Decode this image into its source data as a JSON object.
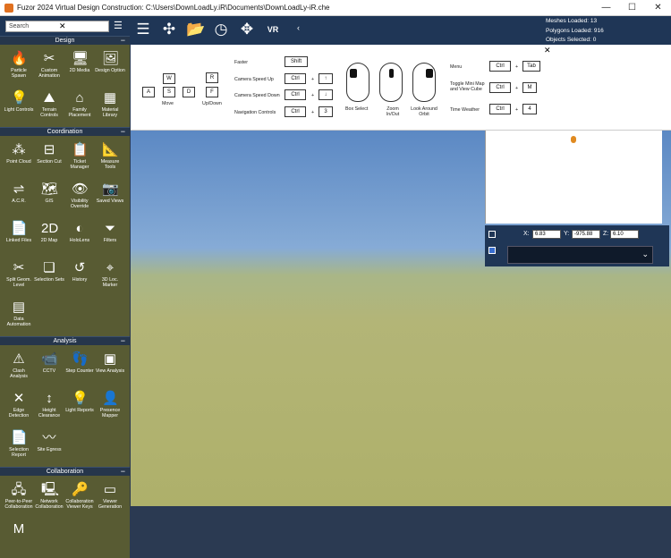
{
  "window": {
    "title": "Fuzor 2024 Virtual Design Construction: C:\\Users\\DownLoadLy.iR\\Documents\\DownLoadLy-iR.che",
    "min": "—",
    "max": "☐",
    "close": "✕"
  },
  "search": {
    "placeholder": "Search",
    "clear": "✕"
  },
  "menu_icon": "☰",
  "toolbar": [
    {
      "name": "list-icon",
      "glyph": "☰"
    },
    {
      "name": "drone-icon",
      "glyph": "✣"
    },
    {
      "name": "folder-icon",
      "glyph": "📂"
    },
    {
      "name": "clock-icon",
      "glyph": "◷"
    },
    {
      "name": "move-icon",
      "glyph": "✥"
    },
    {
      "name": "vr-icon",
      "glyph": "VR"
    }
  ],
  "collapse_arrow": "‹",
  "stats": {
    "meshes": "Meshes Loaded: 13",
    "polygons": "Polygons Loaded: 916",
    "objects": "Objects Selected: 0"
  },
  "sections": [
    {
      "title": "Design",
      "items": [
        {
          "label": "Particle Spawn",
          "icon": "flame-icon",
          "glyph": "🔥"
        },
        {
          "label": "Custom Animation",
          "icon": "animation-icon",
          "glyph": "✂"
        },
        {
          "label": "2D Media",
          "icon": "monitor-icon",
          "glyph": "🖥"
        },
        {
          "label": "Design Option",
          "icon": "image-icon",
          "glyph": "🖼"
        },
        {
          "label": "Light Controls",
          "icon": "light-icon",
          "glyph": "💡"
        },
        {
          "label": "Terrain Controls",
          "icon": "terrain-icon",
          "glyph": "⛰"
        },
        {
          "label": "Family Placement",
          "icon": "family-icon",
          "glyph": "⌂"
        },
        {
          "label": "Material Library",
          "icon": "material-icon",
          "glyph": "▦"
        }
      ]
    },
    {
      "title": "Coordination",
      "items": [
        {
          "label": "Point Cloud",
          "icon": "point-cloud-icon",
          "glyph": "⁂"
        },
        {
          "label": "Section Cut",
          "icon": "section-cut-icon",
          "glyph": "⊟"
        },
        {
          "label": "Ticket Manager",
          "icon": "ticket-icon",
          "glyph": "📋"
        },
        {
          "label": "Measure Tools",
          "icon": "measure-icon",
          "glyph": "📐"
        },
        {
          "label": "A.C.R.",
          "icon": "acr-icon",
          "glyph": "⇌"
        },
        {
          "label": "GIS",
          "icon": "gis-icon",
          "glyph": "🗺"
        },
        {
          "label": "Visibility Override",
          "icon": "eye-icon",
          "glyph": "👁"
        },
        {
          "label": "Saved Views",
          "icon": "saved-views-icon",
          "glyph": "📷"
        },
        {
          "label": "Linked Files",
          "icon": "linked-files-icon",
          "glyph": "📄"
        },
        {
          "label": "2D Map",
          "icon": "map-2d-icon",
          "glyph": "2D"
        },
        {
          "label": "HoloLens",
          "icon": "hololens-icon",
          "glyph": "◐"
        },
        {
          "label": "Filters",
          "icon": "filter-icon",
          "glyph": "⏷"
        },
        {
          "label": "Split Geom. Level",
          "icon": "split-icon",
          "glyph": "✂"
        },
        {
          "label": "Selection Sets",
          "icon": "selection-sets-icon",
          "glyph": "❏"
        },
        {
          "label": "History",
          "icon": "history-icon",
          "glyph": "↺"
        },
        {
          "label": "3D Loc. Marker",
          "icon": "marker-icon",
          "glyph": "⌖"
        },
        {
          "label": "Data Automation",
          "icon": "data-icon",
          "glyph": "▤"
        }
      ]
    },
    {
      "title": "Analysis",
      "items": [
        {
          "label": "Clash Analysis",
          "icon": "clash-icon",
          "glyph": "⚠"
        },
        {
          "label": "CCTV",
          "icon": "cctv-icon",
          "glyph": "📹"
        },
        {
          "label": "Step Counter",
          "icon": "footsteps-icon",
          "glyph": "👣"
        },
        {
          "label": "View Analysis",
          "icon": "view-analysis-icon",
          "glyph": "▣"
        },
        {
          "label": "Edge Detection",
          "icon": "edge-icon",
          "glyph": "✕"
        },
        {
          "label": "Height Clearance",
          "icon": "height-icon",
          "glyph": "↕"
        },
        {
          "label": "Light Reports",
          "icon": "light-report-icon",
          "glyph": "💡"
        },
        {
          "label": "Presence Mapper",
          "icon": "presence-icon",
          "glyph": "👤"
        },
        {
          "label": "Selection Report",
          "icon": "report-icon",
          "glyph": "📄"
        },
        {
          "label": "Site Egress",
          "icon": "egress-icon",
          "glyph": "〰"
        }
      ]
    },
    {
      "title": "Collaboration",
      "items": [
        {
          "label": "Peer-to-Peer Collaboration",
          "icon": "p2p-icon",
          "glyph": "🖧"
        },
        {
          "label": "Network Collaboration",
          "icon": "network-icon",
          "glyph": "🖳"
        },
        {
          "label": "Collaboration Viewer Keys",
          "icon": "keys-icon",
          "glyph": "🔑"
        },
        {
          "label": "Viewer Generation",
          "icon": "viewer-icon",
          "glyph": "▭"
        },
        {
          "label": "",
          "icon": "m-icon",
          "glyph": "M"
        }
      ]
    }
  ],
  "section_collapse": "−",
  "controls": {
    "move_label": "Move",
    "updown_label": "Up/Down",
    "keys_move": {
      "w": "W",
      "a": "A",
      "s": "S",
      "d": "D",
      "r": "R",
      "f": "F"
    },
    "faster": "Faster",
    "faster_key": "Shift",
    "speed_up": "Camera Speed Up",
    "speed_down": "Camera Speed Down",
    "nav": "Navigation Controls",
    "ctrl": "Ctrl",
    "plus": "+",
    "up": "↑",
    "down": "↓",
    "three": "3",
    "box_select": "Box Select",
    "zoom": "Zoom In/Out",
    "look": "Look Around Orbit",
    "menu": "Menu",
    "tab": "Tab",
    "toggle_map": "Toggle Mini Map and View Cube",
    "m": "M",
    "time_weather": "Time Weather",
    "four": "4"
  },
  "close_panel": "✕",
  "coords": {
    "x_label": "X:",
    "x": "6.83",
    "y_label": "Y:",
    "y": "-975.88",
    "z_label": "Z:",
    "z": "6.10"
  },
  "dropdown_arrow": "⌄"
}
